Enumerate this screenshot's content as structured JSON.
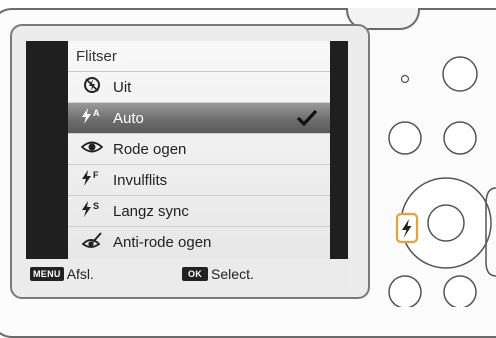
{
  "menu": {
    "title": "Flitser",
    "items": [
      {
        "icon": "flash-off-icon",
        "icon_glyph": "⚡̸",
        "label": "Uit"
      },
      {
        "icon": "flash-auto-icon",
        "icon_glyph": "ϟᴬ",
        "label": "Auto"
      },
      {
        "icon": "red-eye-icon",
        "icon_glyph": "◉",
        "label": "Rode ogen"
      },
      {
        "icon": "fill-in-flash-icon",
        "icon_glyph": "ϟᶠ",
        "label": "Invulflits"
      },
      {
        "icon": "slow-sync-icon",
        "icon_glyph": "ϟˢ",
        "label": "Langz sync"
      },
      {
        "icon": "red-eye-fix-icon",
        "icon_glyph": "✎",
        "label": "Anti-rode ogen"
      }
    ],
    "selected_label": "Auto"
  },
  "softkeys": {
    "menu_key": "MENU",
    "menu_label": "Afsl.",
    "ok_key": "OK",
    "ok_label": "Select."
  },
  "highlight_color": "#f0a030"
}
